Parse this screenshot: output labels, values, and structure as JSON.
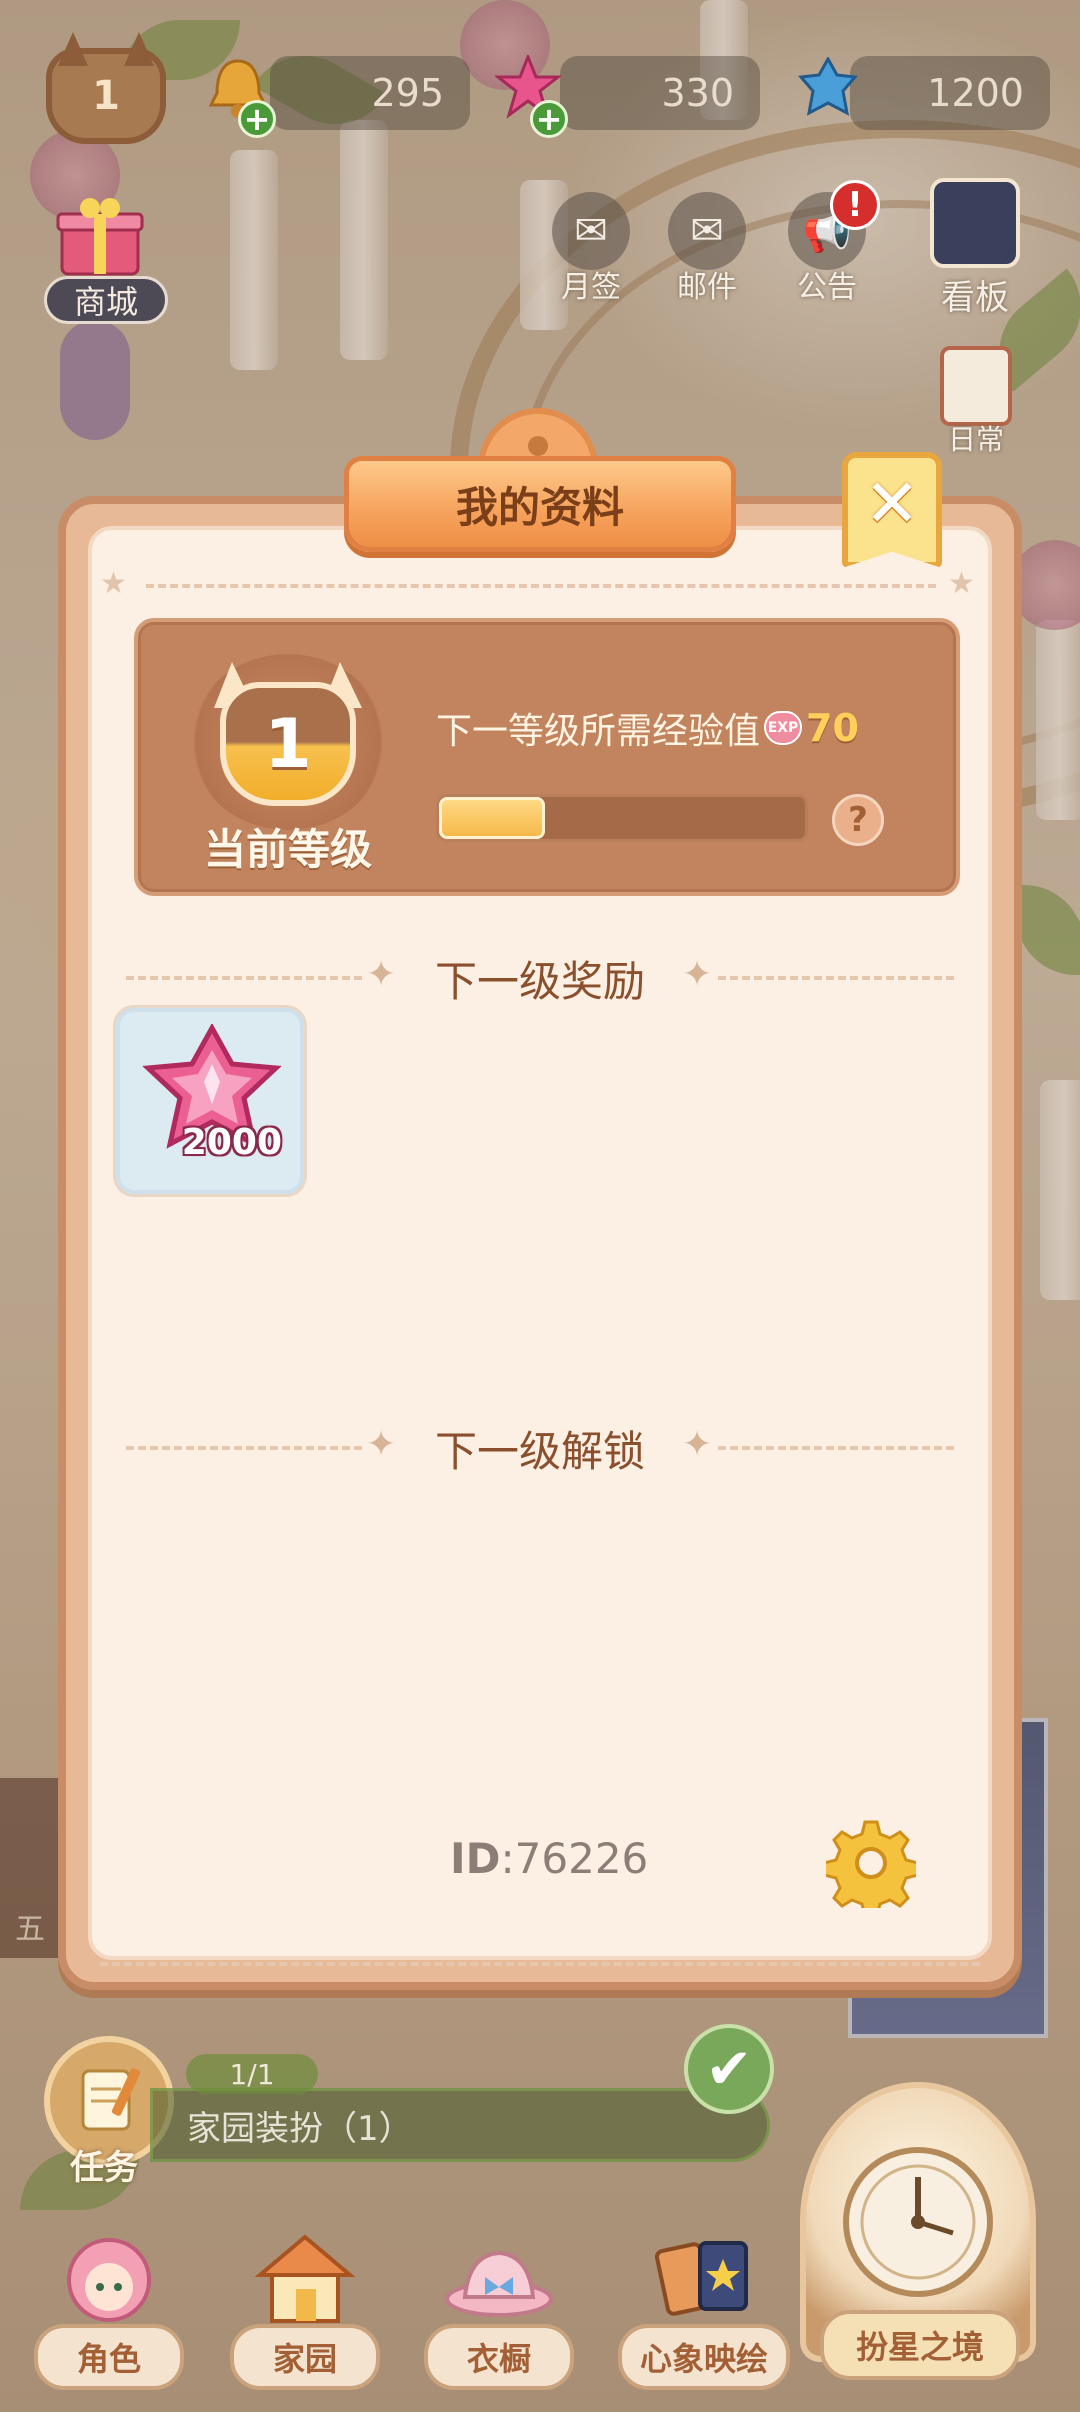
{
  "topbar": {
    "player_level": "1",
    "resources": [
      {
        "name": "bell",
        "icon": "bell-icon",
        "value": "295",
        "has_plus": true
      },
      {
        "name": "pink-gem",
        "icon": "pink-gem-icon",
        "value": "330",
        "has_plus": true
      },
      {
        "name": "blue-crystal",
        "icon": "blue-crystal-icon",
        "value": "1200",
        "has_plus": false
      }
    ]
  },
  "side_buttons": {
    "shop": "商城",
    "monthly_checkin": "月签",
    "mail": "邮件",
    "notice": "公告",
    "notice_alert": "!",
    "board": "看板",
    "daily": "日常"
  },
  "dialog": {
    "title": "我的资料",
    "close_symbol": "✕",
    "level_panel": {
      "current_level": "1",
      "current_level_label": "当前等级",
      "next_exp_label": "下一等级所需经验值",
      "exp_icon_text": "EXP",
      "next_exp_value": "70",
      "progress_fraction": 0.29,
      "help_symbol": "?"
    },
    "next_reward_title": "下一级奖励",
    "rewards": [
      {
        "icon": "pink-star-gem-icon",
        "amount": "2000"
      }
    ],
    "next_unlock_title": "下一级解锁",
    "id_label": "ID",
    "id_value": "76226"
  },
  "bottom": {
    "task_label": "任务",
    "task_progress": "1/1",
    "task_text": "家园装扮（1）",
    "nav": [
      {
        "label": "角色",
        "icon": "character-icon"
      },
      {
        "label": "家园",
        "icon": "home-icon"
      },
      {
        "label": "衣橱",
        "icon": "wardrobe-icon"
      },
      {
        "label": "心象映绘",
        "icon": "cards-icon"
      }
    ],
    "clock_label": "扮星之境",
    "left_partial_text": "五"
  },
  "colors": {
    "dialog_frame": "#c88d66",
    "dialog_bg": "#fcefe4",
    "level_panel_bg": "#c2845f",
    "title_banner": "#f6a25c",
    "exp_value": "#ffd05a",
    "section_title": "#8a4f2d"
  }
}
